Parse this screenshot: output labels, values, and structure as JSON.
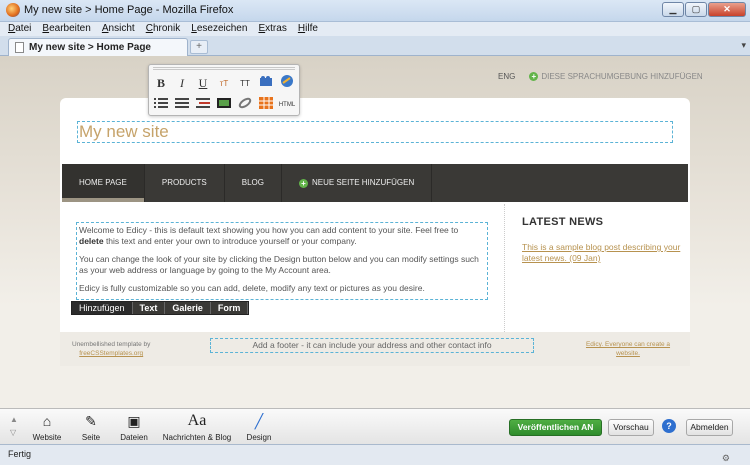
{
  "window": {
    "title": "My new site > Home Page - Mozilla Firefox"
  },
  "menu": [
    "Datei",
    "Bearbeiten",
    "Ansicht",
    "Chronik",
    "Lesezeichen",
    "Extras",
    "Hilfe"
  ],
  "tab": {
    "label": "My new site > Home Page",
    "new_tab": "+"
  },
  "lang": {
    "current": "ENG",
    "add": "DIESE SPRACHUMGEBUNG HINZUFÜGEN"
  },
  "toolbar": {
    "bold": "B",
    "italic": "I",
    "underline": "U",
    "font_size_down": "ᴛT",
    "font_size_up": "TT",
    "html": "HTML"
  },
  "site": {
    "title": "My new site",
    "nav": [
      "HOME PAGE",
      "PRODUCTS",
      "BLOG"
    ],
    "nav_add": "NEUE SEITE HINZUFÜGEN",
    "content": {
      "p1a": "Welcome to Edicy - this is default text showing you how you can add content to your site. Feel free to ",
      "p1b": "delete",
      "p1c": " this text and enter your own to introduce yourself or your company.",
      "p2": "You can change the look of your site by clicking the Design button below and you can modify settings such as your web address or language by going to the My Account area.",
      "p3": "Edicy is fully customizable so you can add, delete, modify any text or pictures as you desire."
    },
    "news_title": "LATEST NEWS",
    "news_link": "This is a sample blog post describing your latest news. (09 Jan)",
    "addbar": [
      "Hinzufügen",
      "Text",
      "Galerie",
      "Form"
    ],
    "footer": {
      "credit1": "Unembellished template by",
      "credit2": "freeCSStemplates.org",
      "field": "Add a footer - it can include your address and other contact info",
      "edicy1": "Edicy. Everyone can create a",
      "edicy2": "website."
    }
  },
  "apptools": {
    "tools": [
      "Website",
      "Seite",
      "Dateien",
      "Nachrichten & Blog",
      "Design"
    ],
    "publish": "Veröffentlichen AN",
    "preview": "Vorschau",
    "help": "?",
    "logout": "Abmelden"
  },
  "status": "Fertig"
}
